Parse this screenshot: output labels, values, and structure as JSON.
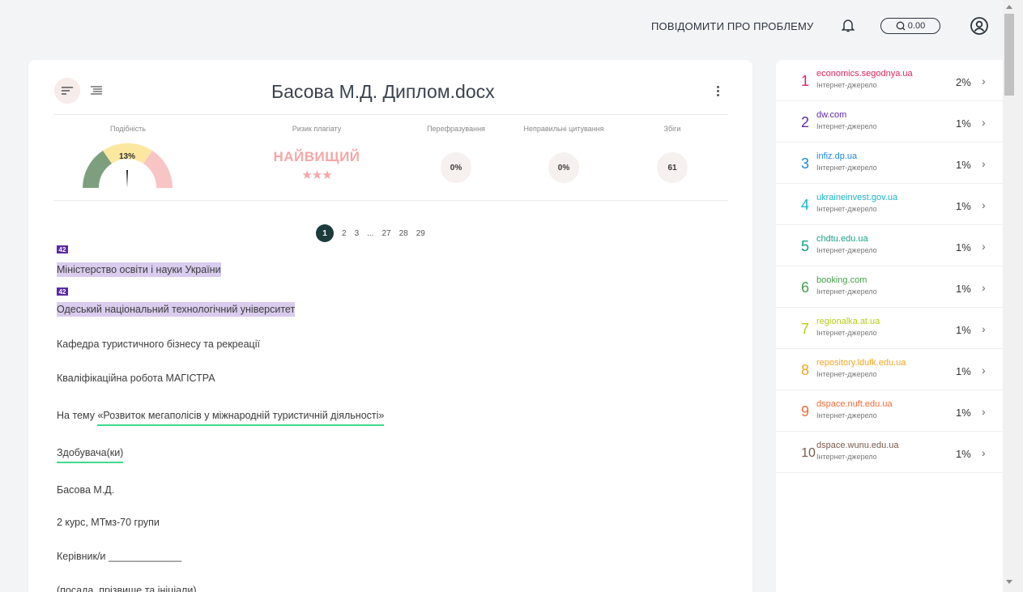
{
  "header": {
    "report_label": "ПОВІДОМИТИ ПРО ПРОБЛЕМУ",
    "balance": "0.00"
  },
  "document": {
    "title": "Басова М.Д. Диплом.docx",
    "stats": {
      "similarity_label": "Подібність",
      "similarity_value": "13%",
      "risk_label": "Ризик плагіату",
      "risk_value": "НАЙВИЩИЙ",
      "risk_stars": "★★★",
      "paraphrase_label": "Перефразування",
      "paraphrase_value": "0%",
      "citations_label": "Неправильні цитування",
      "citations_value": "0%",
      "matches_label": "Збіги",
      "matches_value": "61"
    },
    "pagination": {
      "pages": [
        "1",
        "2",
        "3",
        "...",
        "27",
        "28",
        "29"
      ]
    },
    "paragraphs": {
      "badge1": "42",
      "p1": "Міністерство освіти і науки України",
      "badge2": "42",
      "p2": "Одеський національний технологічний університет",
      "p3": "Кафедра туристичного бізнесу та рекреації",
      "p4": "Кваліфікаційна робота МАГІСТРА",
      "p5_prefix": "На тему ",
      "p5_underlined": "«Розвиток мегаполісів у міжнародній туристичній діяльності»",
      "p6": "Здобувача(ки)",
      "p7": "Басова М.Д.",
      "p8": "2 курс, МТмз-70 групи",
      "p9": "Керівник/и _____________",
      "p10": "(посада, прізвище та ініціали)"
    }
  },
  "sources": [
    {
      "num": "1",
      "domain": "economics.segodnya.ua",
      "type": "Інтернет-джерело",
      "percent": "2%",
      "color": "#e0245e"
    },
    {
      "num": "2",
      "domain": "dw.com",
      "type": "Інтернет-джерело",
      "percent": "1%",
      "color": "#5b2aa8"
    },
    {
      "num": "3",
      "domain": "infiz.dp.ua",
      "type": "Інтернет-джерело",
      "percent": "1%",
      "color": "#1e88e5"
    },
    {
      "num": "4",
      "domain": "ukraineinvest.gov.ua",
      "type": "Інтернет-джерело",
      "percent": "1%",
      "color": "#17b5c9"
    },
    {
      "num": "5",
      "domain": "chdtu.edu.ua",
      "type": "Інтернет-джерело",
      "percent": "1%",
      "color": "#16a085"
    },
    {
      "num": "6",
      "domain": "booking.com",
      "type": "Інтернет-джерело",
      "percent": "1%",
      "color": "#43a047"
    },
    {
      "num": "7",
      "domain": "regionalka.at.ua",
      "type": "Інтернет-джерело",
      "percent": "1%",
      "color": "#b5cc18"
    },
    {
      "num": "8",
      "domain": "repository.ldufk.edu.ua",
      "type": "Інтернет-джерело",
      "percent": "1%",
      "color": "#f5a623"
    },
    {
      "num": "9",
      "domain": "dspace.nuft.edu.ua",
      "type": "Інтернет-джерело",
      "percent": "1%",
      "color": "#ef6c3a"
    },
    {
      "num": "10",
      "domain": "dspace.wunu.edu.ua",
      "type": "Інтернет-джерело",
      "percent": "1%",
      "color": "#7b5a4a"
    }
  ]
}
